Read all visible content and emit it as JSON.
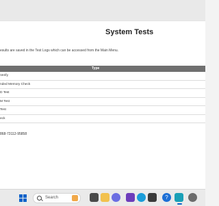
{
  "page": {
    "title": "System Tests",
    "info_text": "esults are saved in the Test Logs which can be accessed from the Main Menu.",
    "footer_id": "868-73112-95858"
  },
  "table": {
    "header": "Type",
    "rows": [
      "Verify",
      "nded Memory Check",
      "D Test",
      "M Test",
      "Test",
      "eck"
    ]
  },
  "taskbar": {
    "search_label": "Search",
    "icons": [
      "windows-start-icon",
      "search-icon",
      "task-view-icon",
      "file-explorer-icon",
      "teams-icon",
      "edge-icon",
      "security-icon",
      "help-icon",
      "store-icon",
      "active-app-icon",
      "settings-icon"
    ]
  },
  "colors": {
    "accent": "#0a62c9",
    "header_bg": "#6f6f6f"
  }
}
